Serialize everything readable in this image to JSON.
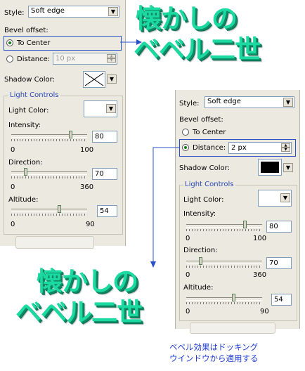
{
  "panel1": {
    "style_label": "Style:",
    "style_value": "Soft edge",
    "bevel_label": "Bevel offset:",
    "to_center": "To Center",
    "distance": "Distance:",
    "distance_value": "10 px",
    "shadow_label": "Shadow Color:",
    "group": "Light Controls",
    "light_color": "Light Color:",
    "intensity": "Intensity:",
    "intensity_value": "80",
    "intensity_min": "0",
    "intensity_max": "100",
    "direction": "Direction:",
    "direction_value": "70",
    "direction_min": "0",
    "direction_max": "360",
    "altitude": "Altitude:",
    "altitude_value": "54",
    "altitude_min": "0",
    "altitude_max": "90"
  },
  "panel2": {
    "style_label": "Style:",
    "style_value": "Soft edge",
    "bevel_label": "Bevel offset:",
    "to_center": "To Center",
    "distance": "Distance:",
    "distance_value": "2 px",
    "shadow_label": "Shadow Color:",
    "group": "Light Controls",
    "light_color": "Light Color:",
    "intensity": "Intensity:",
    "intensity_value": "80",
    "intensity_min": "0",
    "intensity_max": "100",
    "direction": "Direction:",
    "direction_value": "70",
    "direction_min": "0",
    "direction_max": "360",
    "altitude": "Altitude:",
    "altitude_value": "54",
    "altitude_min": "0",
    "altitude_max": "90"
  },
  "titles": {
    "top_line1": "懐かしの",
    "top_line2": "ベベル二世",
    "bottom_line1": "懐かしの",
    "bottom_line2": "ベベル二世"
  },
  "caption": {
    "line1": "ベベル効果はドッキング",
    "line2": "ウインドウから適用する"
  },
  "colors": {
    "title_green": "#1bd9a0",
    "caption_blue": "#1f3fd6",
    "highlight_blue": "#2a50c8"
  }
}
